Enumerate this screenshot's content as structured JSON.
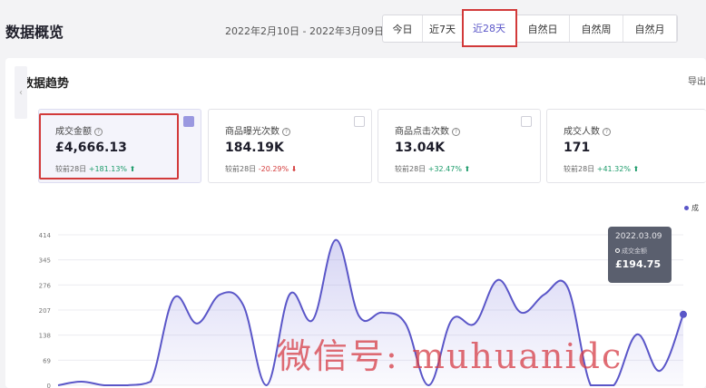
{
  "header": {
    "title": "数据概览",
    "date_range": "2022年2月10日 - 2022年3月09日",
    "tabs": [
      {
        "label": "今日",
        "active": false
      },
      {
        "label": "近7天",
        "active": false
      },
      {
        "label": "近28天",
        "active": true
      },
      {
        "label": "自然日",
        "active": false
      },
      {
        "label": "自然周",
        "active": false
      },
      {
        "label": "自然月",
        "active": false
      }
    ]
  },
  "trend": {
    "title": "数据趋势",
    "export_label": "导出",
    "prev_arrow": "‹",
    "legend_label": "成",
    "cards": [
      {
        "label": "成交金额",
        "value": "£4,666.13",
        "compare_prefix": "较前28日",
        "change": "+181.13%",
        "trend_arrow": "⬆",
        "direction": "up",
        "selected": true
      },
      {
        "label": "商品曝光次数",
        "value": "184.19K",
        "compare_prefix": "较前28日",
        "change": "-20.29%",
        "trend_arrow": "⬇",
        "direction": "down",
        "selected": false
      },
      {
        "label": "商品点击次数",
        "value": "13.04K",
        "compare_prefix": "较前28日",
        "change": "+32.47%",
        "trend_arrow": "⬆",
        "direction": "up",
        "selected": false
      },
      {
        "label": "成交人数",
        "value": "171",
        "compare_prefix": "较前28日",
        "change": "+41.32%",
        "trend_arrow": "⬆",
        "direction": "up",
        "selected": false
      }
    ],
    "help_glyph": "?"
  },
  "chart_data": {
    "type": "area",
    "y_ticks": [
      "414",
      "345",
      "276",
      "207",
      "138",
      "69",
      "0"
    ],
    "ylim": [
      0,
      414
    ],
    "series": [
      {
        "name": "成交金额",
        "color": "#5a56c8",
        "values": [
          0,
          10,
          0,
          0,
          10,
          240,
          170,
          250,
          220,
          0,
          250,
          180,
          400,
          190,
          200,
          170,
          0,
          180,
          170,
          290,
          200,
          250,
          270,
          0,
          0,
          140,
          40,
          195
        ]
      }
    ]
  },
  "tooltip": {
    "date": "2022.03.09",
    "series_label": "成交金额",
    "value": "£194.75"
  },
  "watermark": "微信号: muhuanidc"
}
